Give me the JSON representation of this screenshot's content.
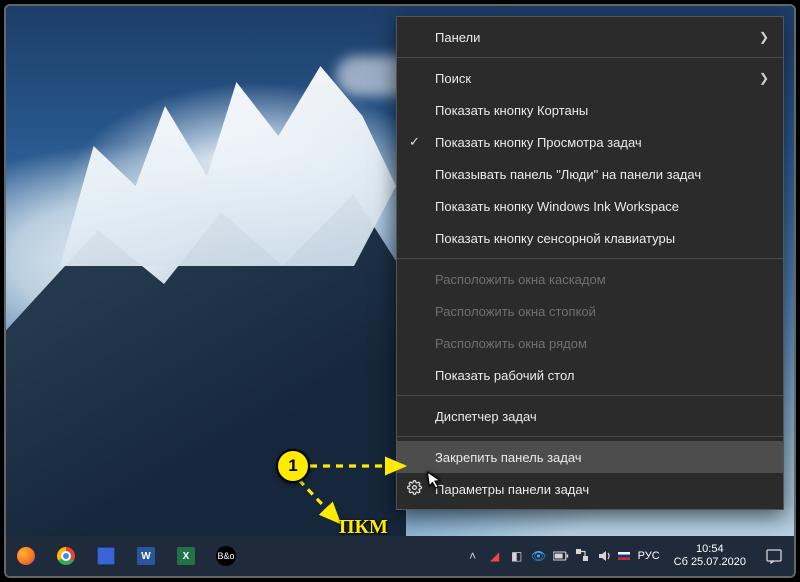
{
  "context_menu": {
    "panels": {
      "label": "Панели",
      "has_submenu": true
    },
    "search": {
      "label": "Поиск",
      "has_submenu": true
    },
    "cortana": {
      "label": "Показать кнопку Кортаны"
    },
    "taskview": {
      "label": "Показать кнопку Просмотра задач",
      "checked": true
    },
    "people": {
      "label": "Показывать панель \"Люди\" на панели задач"
    },
    "ink": {
      "label": "Показать кнопку Windows Ink Workspace"
    },
    "touchkb": {
      "label": "Показать кнопку сенсорной клавиатуры"
    },
    "cascade": {
      "label": "Расположить окна каскадом",
      "disabled": true
    },
    "stack": {
      "label": "Расположить окна стопкой",
      "disabled": true
    },
    "side": {
      "label": "Расположить окна рядом",
      "disabled": true
    },
    "showdesk": {
      "label": "Показать рабочий стол"
    },
    "taskmgr": {
      "label": "Диспетчер задач"
    },
    "lock": {
      "label": "Закрепить панель задач",
      "hovered": true
    },
    "settings": {
      "label": "Параметры панели задач",
      "icon": "gear"
    }
  },
  "taskbar": {
    "apps": [
      {
        "name": "firefox",
        "glyph": ""
      },
      {
        "name": "chrome",
        "glyph": ""
      },
      {
        "name": "save",
        "glyph": ""
      },
      {
        "name": "word",
        "glyph": "W"
      },
      {
        "name": "excel",
        "glyph": "X"
      },
      {
        "name": "bo-audio",
        "glyph": "B&o"
      }
    ],
    "tray": {
      "lang": "РУС",
      "time": "10:54",
      "date": "Сб 25.07.2020"
    }
  },
  "annotation": {
    "step": "1",
    "label": "ПКМ"
  }
}
